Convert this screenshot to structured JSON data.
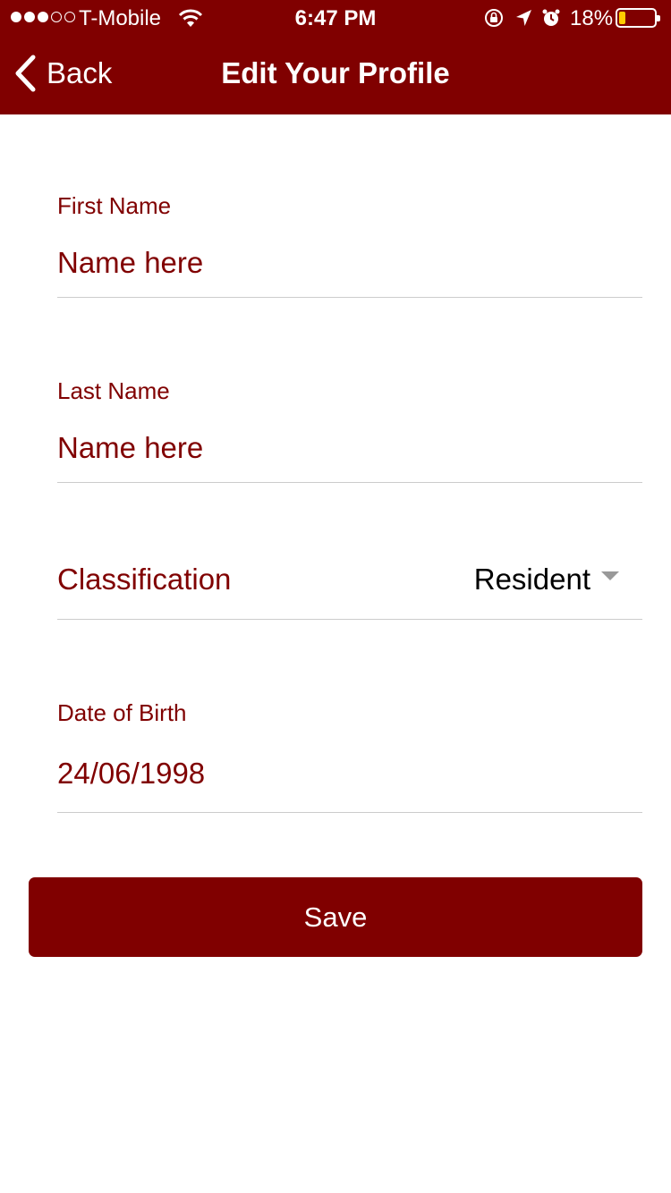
{
  "colors": {
    "brand": "#800000",
    "background": "#ffffff",
    "divider": "#cccccc",
    "battery": "#ffcc00"
  },
  "status_bar": {
    "carrier": "T-Mobile",
    "time": "6:47 PM",
    "battery_percent": "18%",
    "battery_level": 0.18,
    "signal_bars_filled": 3,
    "signal_bars_total": 5,
    "icons": [
      "wifi-icon",
      "rotation-lock-icon",
      "location-arrow-icon",
      "alarm-icon",
      "battery-icon"
    ]
  },
  "nav": {
    "back_label": "Back",
    "back_icon": "chevron-left-icon",
    "title": "Edit Your Profile"
  },
  "form": {
    "first_name": {
      "label": "First Name",
      "value": "",
      "placeholder": "Name here"
    },
    "last_name": {
      "label": "Last Name",
      "value": "",
      "placeholder": "Name here"
    },
    "classification": {
      "label": "Classification",
      "value": "Resident",
      "icon": "caret-down-icon"
    },
    "date_of_birth": {
      "label": "Date of Birth",
      "value": "24/06/1998",
      "placeholder": ""
    }
  },
  "actions": {
    "save_label": "Save"
  }
}
